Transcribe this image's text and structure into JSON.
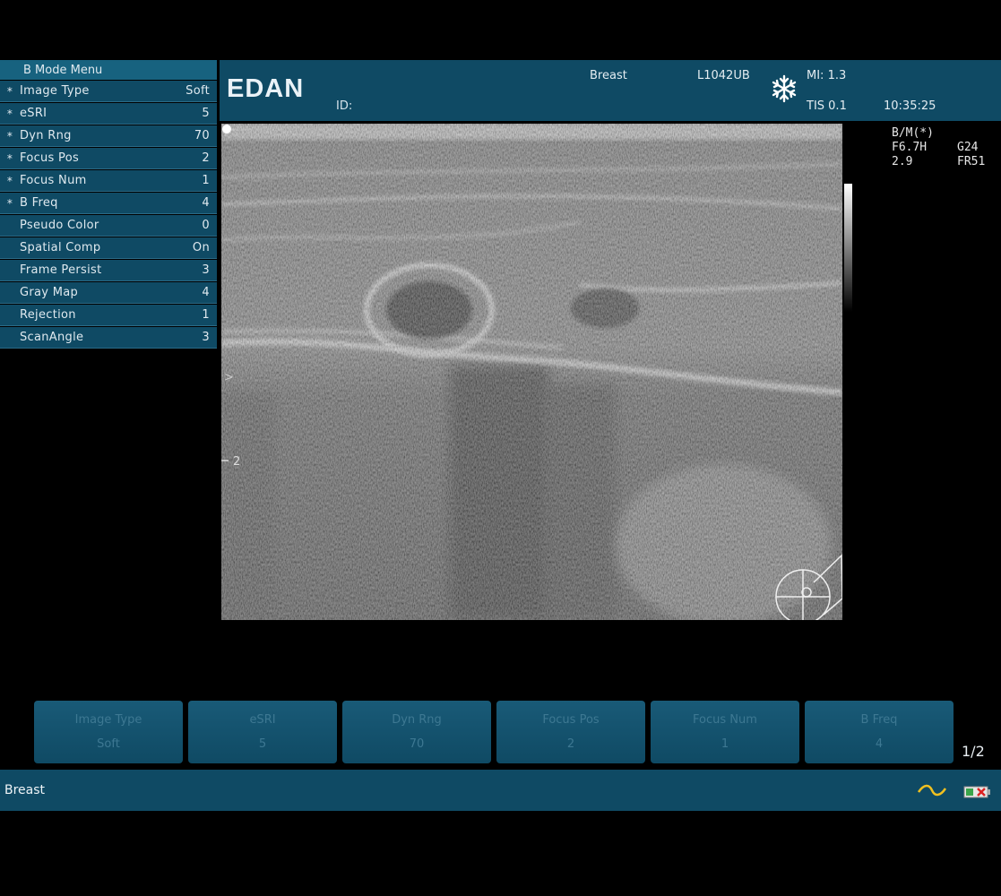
{
  "menu": {
    "title": "B Mode Menu",
    "items": [
      {
        "star": "*",
        "label": "Image Type",
        "value": "Soft"
      },
      {
        "star": "*",
        "label": "eSRI",
        "value": "5"
      },
      {
        "star": "*",
        "label": "Dyn Rng",
        "value": "70"
      },
      {
        "star": "*",
        "label": "Focus Pos",
        "value": "2"
      },
      {
        "star": "*",
        "label": "Focus Num",
        "value": "1"
      },
      {
        "star": "*",
        "label": "B Freq",
        "value": "4"
      },
      {
        "star": "",
        "label": "Pseudo Color",
        "value": "0"
      },
      {
        "star": "",
        "label": "Spatial Comp",
        "value": "On"
      },
      {
        "star": "",
        "label": "Frame Persist",
        "value": "3"
      },
      {
        "star": "",
        "label": "Gray Map",
        "value": "4"
      },
      {
        "star": "",
        "label": "Rejection",
        "value": "1"
      },
      {
        "star": "",
        "label": "ScanAngle",
        "value": "3"
      }
    ]
  },
  "header": {
    "brand": "EDAN",
    "id_label": "ID:",
    "exam": "Breast",
    "probe": "L1042UB",
    "mi": "MI: 1.3",
    "tis": "TIS 0.1",
    "time": "10:35:25",
    "freeze_icon": "snowflake-icon"
  },
  "params": {
    "mode": "B/M(*)",
    "freq": "F6.7H",
    "gain": "G24",
    "depth": "2.9",
    "frame_rate": "FR51"
  },
  "depth_marks": {
    "mark1": ">",
    "mark2": "2"
  },
  "softkeys": [
    {
      "name": "Image Type",
      "value": "Soft"
    },
    {
      "name": "eSRI",
      "value": "5"
    },
    {
      "name": "Dyn Rng",
      "value": "70"
    },
    {
      "name": "Focus Pos",
      "value": "2"
    },
    {
      "name": "Focus Num",
      "value": "1"
    },
    {
      "name": "B Freq",
      "value": "4"
    }
  ],
  "page_indicator": "1/2",
  "bottom": {
    "exam": "Breast"
  },
  "colors": {
    "panel": "#0f4a64",
    "accent": "#17627f"
  }
}
